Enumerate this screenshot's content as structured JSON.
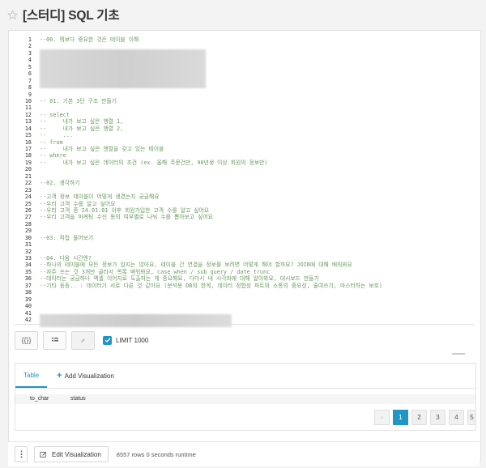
{
  "header": {
    "title": "[스터디] SQL 기초",
    "favorite_icon": "star-outline-icon"
  },
  "editor": {
    "lines": [
      {
        "n": "1",
        "t": "--00. 뭐보다 중요한 것은 테이블 이해"
      },
      {
        "n": "2",
        "t": ""
      },
      {
        "n": "3",
        "t": ""
      },
      {
        "n": "4",
        "t": ""
      },
      {
        "n": "5",
        "t": ""
      },
      {
        "n": "6",
        "t": ""
      },
      {
        "n": "7",
        "t": ""
      },
      {
        "n": "8",
        "t": ""
      },
      {
        "n": "9",
        "t": ""
      },
      {
        "n": "10",
        "t": "-- 01. 기본 3단 구조 만들기"
      },
      {
        "n": "11",
        "t": ""
      },
      {
        "n": "12",
        "t": "-- select"
      },
      {
        "n": "13",
        "t": "--     내가 보고 싶은 행렬 1,"
      },
      {
        "n": "14",
        "t": "--     내가 보고 싶은 행렬 2,"
      },
      {
        "n": "15",
        "t": "--     ..."
      },
      {
        "n": "16",
        "t": "-- from"
      },
      {
        "n": "17",
        "t": "--     내가 보고 싶은 행렬을 갖고 있는 테이블"
      },
      {
        "n": "18",
        "t": "-- where"
      },
      {
        "n": "19",
        "t": "--     내가 보고 싶은 데이터의 조건 (ex. 올해 주문건만, 90년생 이상 회원의 정보만)"
      },
      {
        "n": "20",
        "t": ""
      },
      {
        "n": "21",
        "t": ""
      },
      {
        "n": "22",
        "t": "--02. 생각하기"
      },
      {
        "n": "23",
        "t": ""
      },
      {
        "n": "24",
        "t": "--고객 정보 테이블이 어떻게 생겼는지 궁금해요"
      },
      {
        "n": "25",
        "t": "--우리 고객 수를 알고 싶어요"
      },
      {
        "n": "26",
        "t": "--우리 고객 중 24.01.01 이후 회원가입한 고객 수를 알고 싶어요"
      },
      {
        "n": "27",
        "t": "--우리 고객을 마케팅 수신 동의 여부별로 나눠 수를 뽑아보고 싶어요"
      },
      {
        "n": "28",
        "t": ""
      },
      {
        "n": "29",
        "t": ""
      },
      {
        "n": "30",
        "t": "--03. 직접 풀어보기"
      },
      {
        "n": "31",
        "t": ""
      },
      {
        "n": "32",
        "t": ""
      },
      {
        "n": "33",
        "t": "--04. 다음 시간엔?"
      },
      {
        "n": "34",
        "t": "--하나의 테이블에 모든 정보가 있지는 않아요, 테이블 간 연결을 정보를 보려면 어떻게 해야 할까요? JOIN에 대해 배워봐요"
      },
      {
        "n": "35",
        "t": "--자주 쓰는 것 3개만 골라서 목록 배워봐요, case when / sub query / date_trunc"
      },
      {
        "n": "36",
        "t": "--데이터는 궁금하나 엑셀 이어지로 도출하는 게 중요해요, 다다시 내 시각화에 대해 알아봐요, 대시보드 만들기"
      },
      {
        "n": "37",
        "t": "--기타 등등.. : 데이터가 서로 다른 것 같아요 (분석용 DB의 한계, 데이터 정합성 파트와 소통의 중요성, 줄여쓰기, 마스터하는 보호)"
      },
      {
        "n": "38",
        "t": ""
      },
      {
        "n": "39",
        "t": ""
      },
      {
        "n": "40",
        "t": ""
      },
      {
        "n": "41",
        "t": ""
      },
      {
        "n": "42",
        "t": ""
      }
    ]
  },
  "toolbar": {
    "format_label": "{{}}",
    "limit_checked": true,
    "limit_label": "LIMIT 1000"
  },
  "visualization": {
    "tab_table": "Table",
    "add_label": "Add Visualization",
    "columns": [
      "to_char",
      "status"
    ],
    "pages": [
      "1",
      "2",
      "3",
      "4",
      "5"
    ],
    "active_page": "1",
    "prev_label": "‹"
  },
  "footer": {
    "edit_label": "Edit Visualization",
    "rows_info": "8557 rows   0 seconds runtime"
  }
}
